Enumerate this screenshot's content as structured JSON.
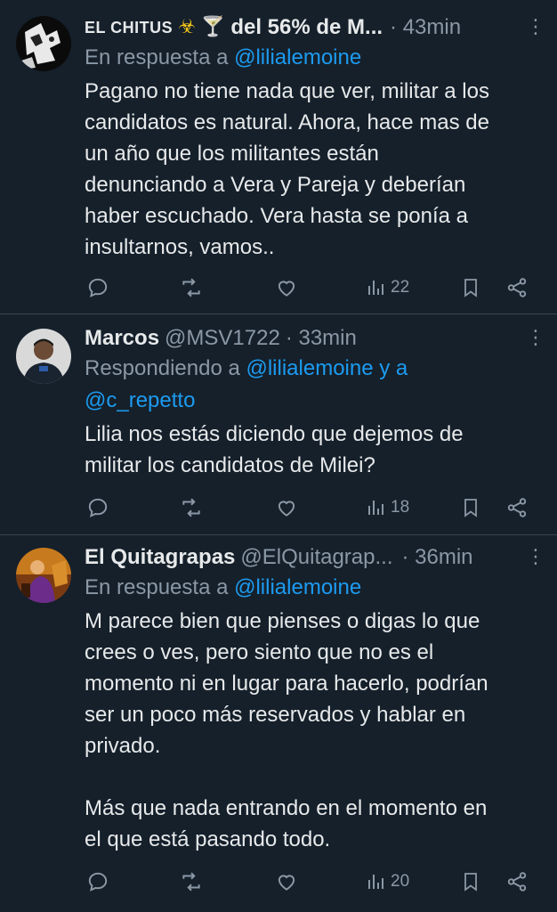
{
  "tweets": [
    {
      "name_part1": "EL CHITUS",
      "emoji1": "☣",
      "emoji2": "🍸",
      "name_part2": "del 56% de M...",
      "handle": "",
      "meta": "· 43min",
      "reply_prefix": "En respuesta a",
      "reply_handles": "@lilialemoine",
      "reply_handles_line2": "",
      "text": "Pagano no tiene nada que ver, militar a los\ncandidatos es natural. Ahora, hace mas de\nun año que los militantes están\ndenunciando a Vera y Pareja y deberían\nhaber escuchado. Vera hasta se ponía a\ninsultarnos, vamos..",
      "views": "22",
      "avatar_icon": "avatar-image"
    },
    {
      "name_part1": "Marcos",
      "handle": "@MSV1722",
      "meta": "· 33min",
      "reply_prefix": "Respondiendo a",
      "reply_handles": "@lilialemoine y a",
      "reply_handles_line2": "@c_repetto",
      "text": "Lilia nos estás diciendo que dejemos de\nmilitar los candidatos de Milei?",
      "views": "18",
      "avatar_icon": "avatar-image"
    },
    {
      "name_part1": "El Quitagrapas",
      "handle": "@ElQuitagrap...",
      "meta": "· 36min",
      "reply_prefix": "En respuesta a",
      "reply_handles": "@lilialemoine",
      "reply_handles_line2": "",
      "text": "M parece bien que pienses o digas lo que\ncrees o ves, pero siento que no es el\nmomento ni en lugar para hacerlo, podrían\nser un poco más reservados y hablar en\nprivado.\n\nMás que nada entrando en el momento en\nel que está pasando todo.",
      "views": "20",
      "avatar_icon": "avatar-image"
    }
  ],
  "icons": [
    "reply-icon",
    "retweet-icon",
    "like-icon",
    "views-icon",
    "bookmark-icon",
    "share-icon",
    "more-icon"
  ],
  "colors": {
    "background": "#15202b",
    "text": "#e7e9ea",
    "muted": "#8b98a5",
    "link": "#1d9bf0",
    "divider": "#38444d"
  }
}
